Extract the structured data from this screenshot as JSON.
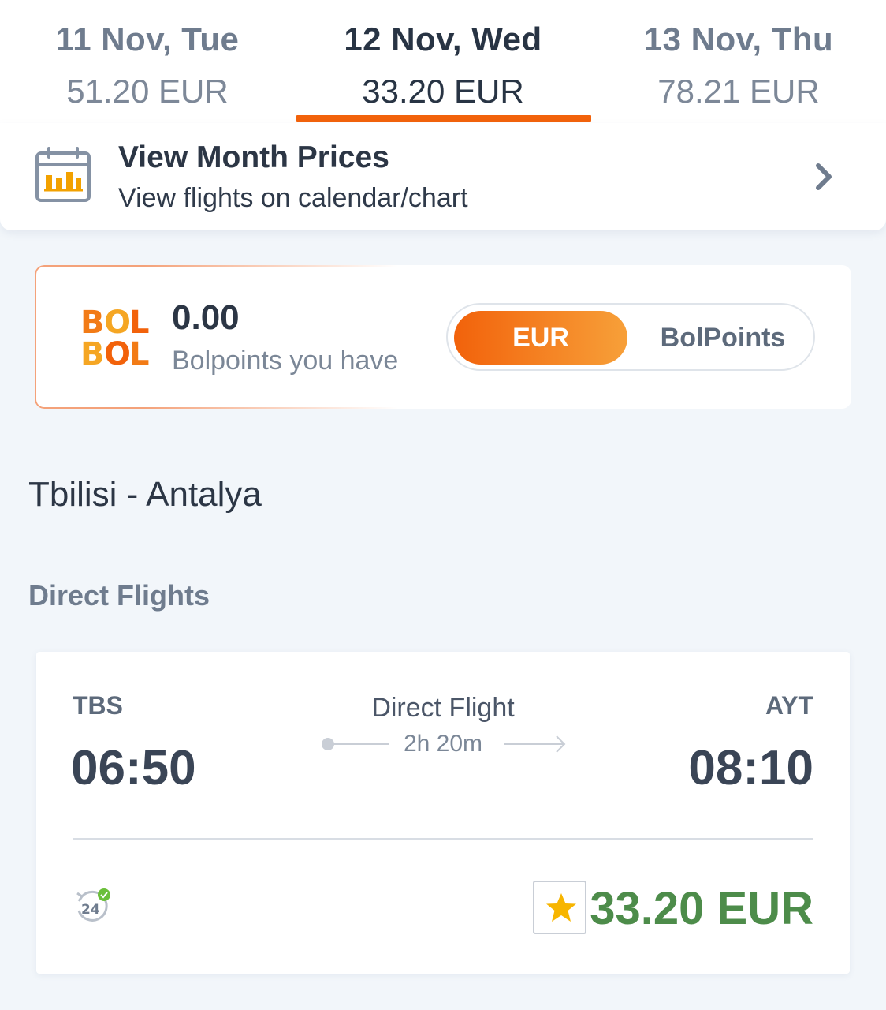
{
  "date_tabs": [
    {
      "label": "11 Nov, Tue",
      "price": "51.20 EUR",
      "active": false
    },
    {
      "label": "12 Nov, Wed",
      "price": "33.20 EUR",
      "active": true
    },
    {
      "label": "13 Nov, Thu",
      "price": "78.21 EUR",
      "active": false
    }
  ],
  "month_prices": {
    "title": "View Month Prices",
    "subtitle": "View flights on calendar/chart",
    "icon": "calendar-chart-icon"
  },
  "bolpoints": {
    "logo_text": "BOLBOL",
    "amount": "0.00",
    "subtitle": "Bolpoints you have",
    "toggle": {
      "eur_label": "EUR",
      "bolpoints_label": "BolPoints",
      "selected": "EUR"
    }
  },
  "route": {
    "title": "Tbilisi - Antalya"
  },
  "section": {
    "title": "Direct Flights"
  },
  "flight": {
    "from_code": "TBS",
    "to_code": "AYT",
    "departure_time": "06:50",
    "arrival_time": "08:10",
    "type": "Direct Flight",
    "duration": "2h 20m",
    "price": "33.20 EUR",
    "support_badge": "24"
  },
  "colors": {
    "accent": "#f2620b",
    "price_green": "#4d8c4a",
    "star": "#f7b500"
  }
}
